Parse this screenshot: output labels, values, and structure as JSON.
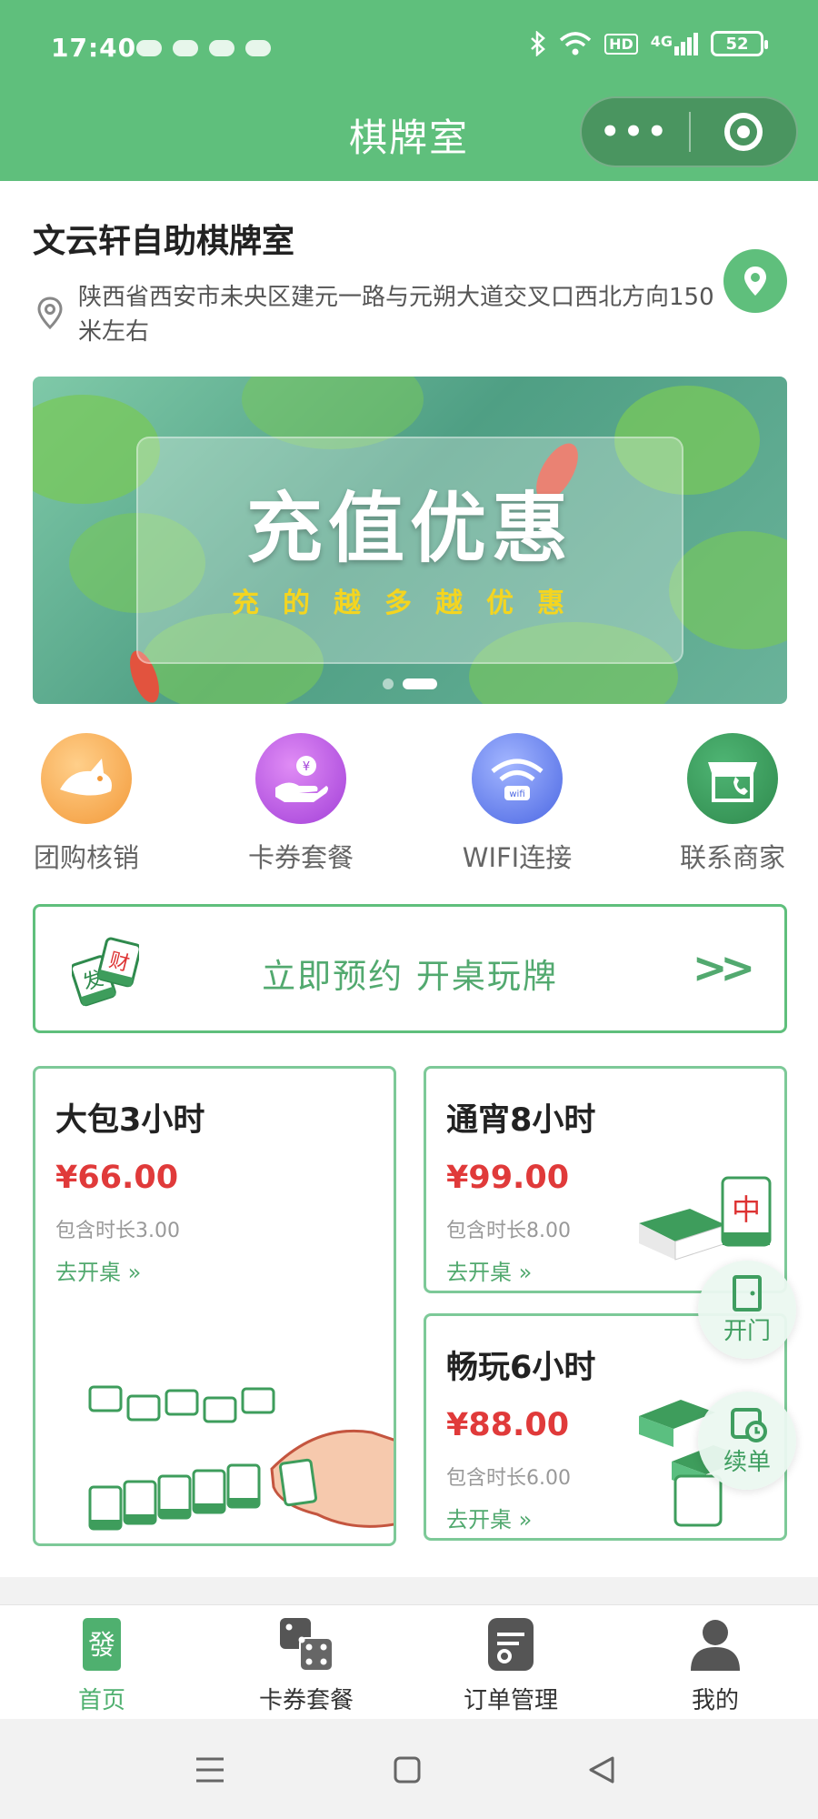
{
  "status_bar": {
    "time": "17:40",
    "net": "HD",
    "signal": "4G",
    "battery": "52"
  },
  "nav": {
    "title": "棋牌室"
  },
  "shop": {
    "name": "文云轩自助棋牌室",
    "address": "陕西省西安市未央区建元一路与元朔大道交叉口西北方向150米左右"
  },
  "banner": {
    "title": "充值优惠",
    "subtitle": "充的越多越优惠",
    "page_count": 2,
    "active_index": 1
  },
  "quick_entries": [
    {
      "label": "团购核销",
      "icon": "fox-icon",
      "color": "#f4a64a"
    },
    {
      "label": "卡券套餐",
      "icon": "hand-coin-icon",
      "color": "#b34fe0"
    },
    {
      "label": "WIFI连接",
      "icon": "wifi-icon",
      "color": "#5a78ea"
    },
    {
      "label": "联系商家",
      "icon": "store-phone-icon",
      "color": "#3e9d5c"
    }
  ],
  "reserve": {
    "label": "立即预约 开桌玩牌",
    "arrow": "»"
  },
  "packages": [
    {
      "name": "大包3小时",
      "price": "¥66.00",
      "duration": "包含时长3.00",
      "action": "去开桌 »"
    },
    {
      "name": "通宵8小时",
      "price": "¥99.00",
      "duration": "包含时长8.00",
      "action": "去开桌 »"
    },
    {
      "name": "畅玩6小时",
      "price": "¥88.00",
      "duration": "包含时长6.00",
      "action": "去开桌 »"
    }
  ],
  "floating": {
    "open_door": "开门",
    "renew": "续单"
  },
  "tabbar": [
    {
      "label": "首页",
      "icon": "mahjong-fa-icon",
      "active": true
    },
    {
      "label": "卡券套餐",
      "icon": "dice-icon",
      "active": false
    },
    {
      "label": "订单管理",
      "icon": "order-icon",
      "active": false
    },
    {
      "label": "我的",
      "icon": "user-icon",
      "active": false
    }
  ],
  "colors": {
    "brand": "#5fbf7c",
    "price": "#e03a3a",
    "accent_text": "#52a96f"
  }
}
